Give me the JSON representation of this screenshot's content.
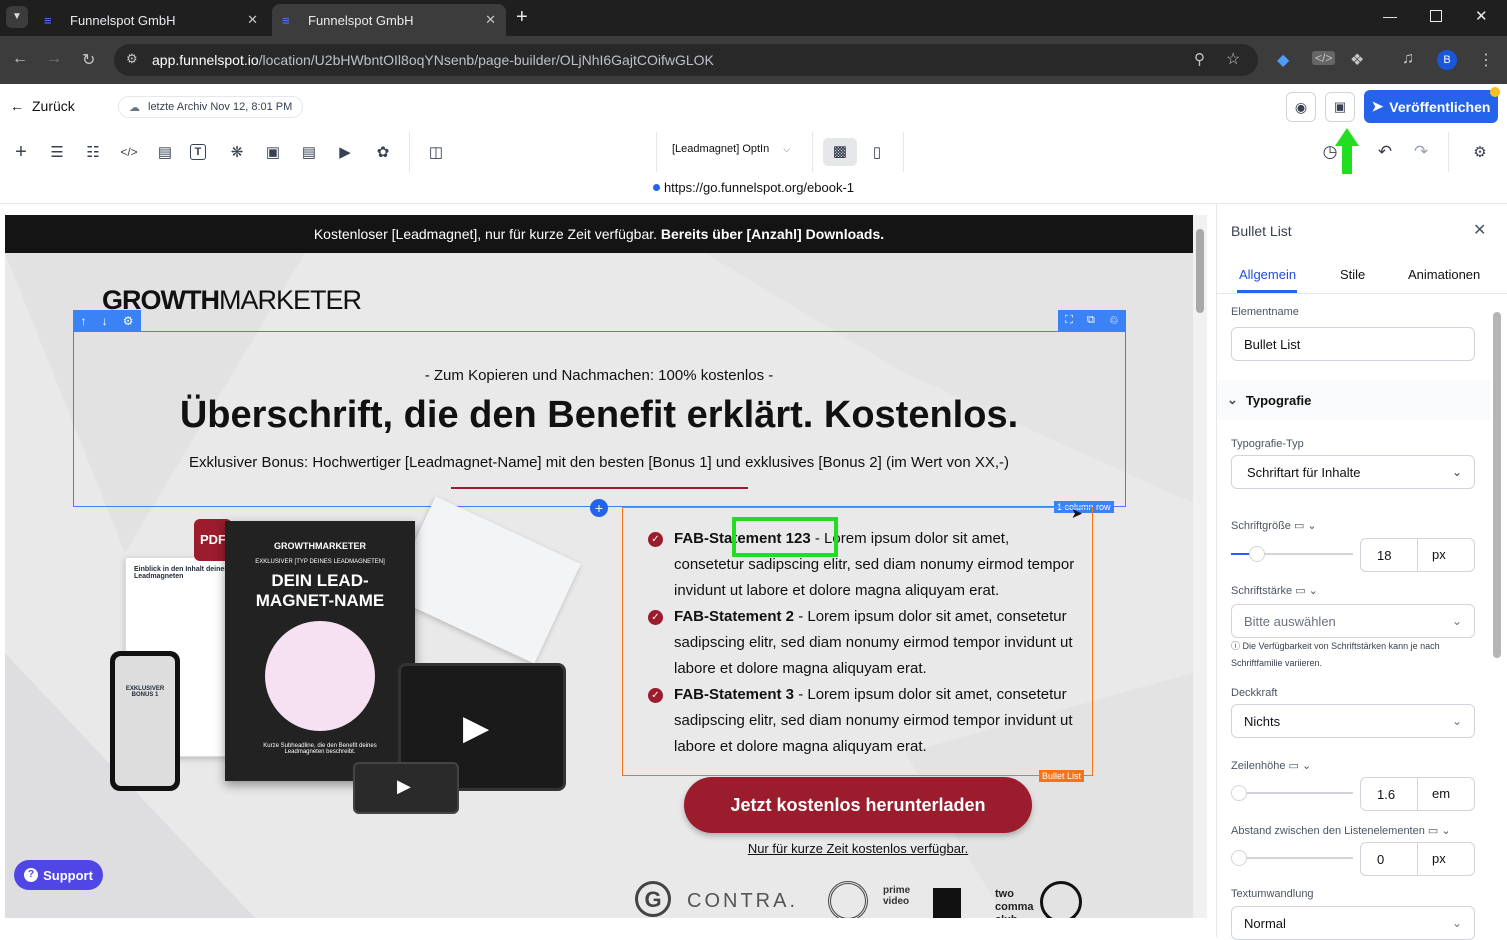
{
  "browser": {
    "tabs": [
      {
        "title": "Funnelspot GmbH",
        "active": false
      },
      {
        "title": "Funnelspot GmbH",
        "active": true
      }
    ],
    "url_host": "app.funnelspot.io",
    "url_path": "/location/U2bHWbntOIl8oqYNsenb/page-builder/OLjNhI6GajtCOifwGLOK",
    "profile_initial": "B"
  },
  "builder": {
    "back_label": "Zurück",
    "archive_label": "letzte Archiv Nov 12, 8:01 PM",
    "publish_label": "Veröffentlichen",
    "page_select": "[Leadmagnet] OptIn",
    "preview_url": "https://go.funnelspot.org/ebook-1"
  },
  "page": {
    "banner_text": "Kostenloser [Leadmagnet], nur für kurze Zeit verfügbar. ",
    "banner_bold": "Bereits über [Anzahl] Downloads.",
    "logo_growth": "GROWTH",
    "logo_marketer": "MARKETER",
    "pre_headline": "- Zum Kopieren und Nachmachen: 100% kostenlos -",
    "headline": "Überschrift, die den Benefit erklärt. Kostenlos.",
    "subheadline": "Exklusiver Bonus: Hochwertiger [Leadmagnet-Name] mit den besten [Bonus 1] und exklusives [Bonus 2] (im Wert von XX,-)",
    "row_tag": "1 column row",
    "bullet_tag": "Bullet List",
    "bullets": [
      {
        "bold": "FAB-Statement 123",
        "text": " - Lorem ipsum dolor sit amet, consetetur sadipscing elitr, sed diam nonumy eirmod tempor invidunt ut labore et dolore magna aliquyam erat."
      },
      {
        "bold": "FAB-Statement 2",
        "text": " - Lorem ipsum dolor sit amet, consetetur sadipscing elitr, sed diam nonumy eirmod tempor invidunt ut labore et dolore magna aliquyam erat."
      },
      {
        "bold": "FAB-Statement 3",
        "text": " - Lorem ipsum dolor sit amet, consetetur sadipscing elitr, sed diam nonumy eirmod tempor invidunt ut labore et dolore magna aliquyam erat."
      }
    ],
    "cta_label": "Jetzt kostenlos herunterladen",
    "cta_sub": "Nur für kurze Zeit kostenlos verfügbar.",
    "book_brand": "GROWTHMARKETER",
    "book_kicker": "EXKLUSIVER [TYP DEINES LEADMAGNETEN]",
    "book_title": "DEIN LEAD-MAGNET-NAME",
    "book_caption": "Kurze Subheadline, die den Benefit deines Leadmagneten beschreibt.",
    "pdf_label": "PDF",
    "paper_title": "Einblick in den Inhalt deines Leadmagneten",
    "phone_title": "EXKLUSIVER BONUS 1",
    "logos": [
      "G",
      "CONTRA.",
      "prime video",
      "two comma club"
    ],
    "support_label": "Support"
  },
  "panel": {
    "title": "Bullet List",
    "tabs": [
      "Allgemein",
      "Stile",
      "Animationen"
    ],
    "elementname_label": "Elementname",
    "elementname_value": "Bullet List",
    "section_typografie": "Typografie",
    "typ_label": "Typografie-Typ",
    "typ_value": "Schriftart für Inhalte",
    "groesse_label": "Schriftgröße",
    "groesse_value": "18",
    "groesse_unit": "px",
    "staerke_label": "Schriftstärke",
    "staerke_value": "Bitte auswählen",
    "staerke_hint": "Die Verfügbarkeit von Schriftstärken kann je nach Schriftfamilie variieren.",
    "deckkraft_label": "Deckkraft",
    "deckkraft_value": "Nichts",
    "zeilen_label": "Zeilenhöhe",
    "zeilen_value": "1.6",
    "zeilen_unit": "em",
    "abstand_label": "Abstand zwischen den Listenelementen",
    "abstand_value": "0",
    "abstand_unit": "px",
    "textum_label": "Textumwandlung",
    "textum_value": "Normal"
  },
  "colors": {
    "accent_blue": "#2563eb",
    "brand_red": "#9b1c2c",
    "highlight_green": "#22dd22"
  }
}
